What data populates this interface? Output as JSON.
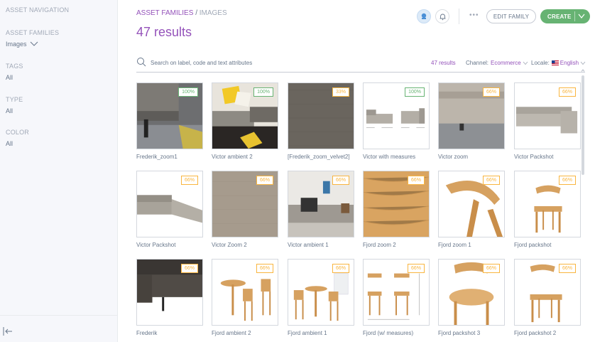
{
  "sidebar": {
    "title": "ASSET NAVIGATION",
    "groups": [
      {
        "label": "ASSET FAMILIES",
        "value": "Images",
        "has_dropdown": true
      },
      {
        "label": "TAGS",
        "value": "All"
      },
      {
        "label": "TYPE",
        "value": "All"
      },
      {
        "label": "COLOR",
        "value": "All"
      }
    ],
    "collapse_icon": "collapse-left-icon"
  },
  "header": {
    "breadcrumb_family": "ASSET FAMILIES",
    "breadcrumb_sep": "/",
    "breadcrumb_current": "IMAGES",
    "results_title": "47 results",
    "more_label": "•••",
    "edit_family_label": "EDIT FAMILY",
    "create_label": "CREATE"
  },
  "search": {
    "placeholder": "Search on label, code and text attributes",
    "value": "",
    "result_count": "47 results",
    "channel_label": "Channel:",
    "channel_value": "Ecommerce",
    "locale_label": "Locale:",
    "locale_value": "English"
  },
  "colors": {
    "accent": "#9452ba",
    "create_green": "#67b373",
    "complete_green": "#67b373",
    "partial_orange": "#f9b53f"
  },
  "assets": [
    {
      "label": "Frederik_zoom1",
      "completeness": "100%",
      "complete": true,
      "kind": "sofa-leg"
    },
    {
      "label": "Victor ambient 2",
      "completeness": "100%",
      "complete": true,
      "kind": "sofa-ambient-yellow"
    },
    {
      "label": "[Frederik_zoom_velvet2]",
      "completeness": "33%",
      "complete": false,
      "kind": "fabric-dark"
    },
    {
      "label": "Victor with measures",
      "completeness": "100%",
      "complete": true,
      "kind": "sofa-measures"
    },
    {
      "label": "Victor zoom",
      "completeness": "66%",
      "complete": false,
      "kind": "sofa-zoom"
    },
    {
      "label": "Victor Packshot",
      "completeness": "66%",
      "complete": false,
      "kind": "sofa-long"
    },
    {
      "label": "Victor Packshot",
      "completeness": "66%",
      "complete": false,
      "kind": "sofa-corner"
    },
    {
      "label": "Victor Zoom 2",
      "completeness": "66%",
      "complete": false,
      "kind": "fabric-beige"
    },
    {
      "label": "Victor ambient 1",
      "completeness": "66%",
      "complete": false,
      "kind": "room"
    },
    {
      "label": "Fjord zoom 2",
      "completeness": "66%",
      "complete": false,
      "kind": "wood"
    },
    {
      "label": "Fjord zoom 1",
      "completeness": "66%",
      "complete": false,
      "kind": "chair-zoom"
    },
    {
      "label": "Fjord packshot",
      "completeness": "66%",
      "complete": false,
      "kind": "chair"
    },
    {
      "label": "Frederik",
      "completeness": "66%",
      "complete": false,
      "kind": "sofa-dark"
    },
    {
      "label": "Fjord ambient 2",
      "completeness": "66%",
      "complete": false,
      "kind": "table-set"
    },
    {
      "label": "Fjord ambient 1",
      "completeness": "66%",
      "complete": false,
      "kind": "table-set-2"
    },
    {
      "label": "Fjord (w/ measures)",
      "completeness": "66%",
      "complete": false,
      "kind": "chair-measures"
    },
    {
      "label": "Fjord packshot 3",
      "completeness": "66%",
      "complete": false,
      "kind": "chair-back"
    },
    {
      "label": "Fjord packshot 2",
      "completeness": "66%",
      "complete": false,
      "kind": "chair-side"
    }
  ]
}
